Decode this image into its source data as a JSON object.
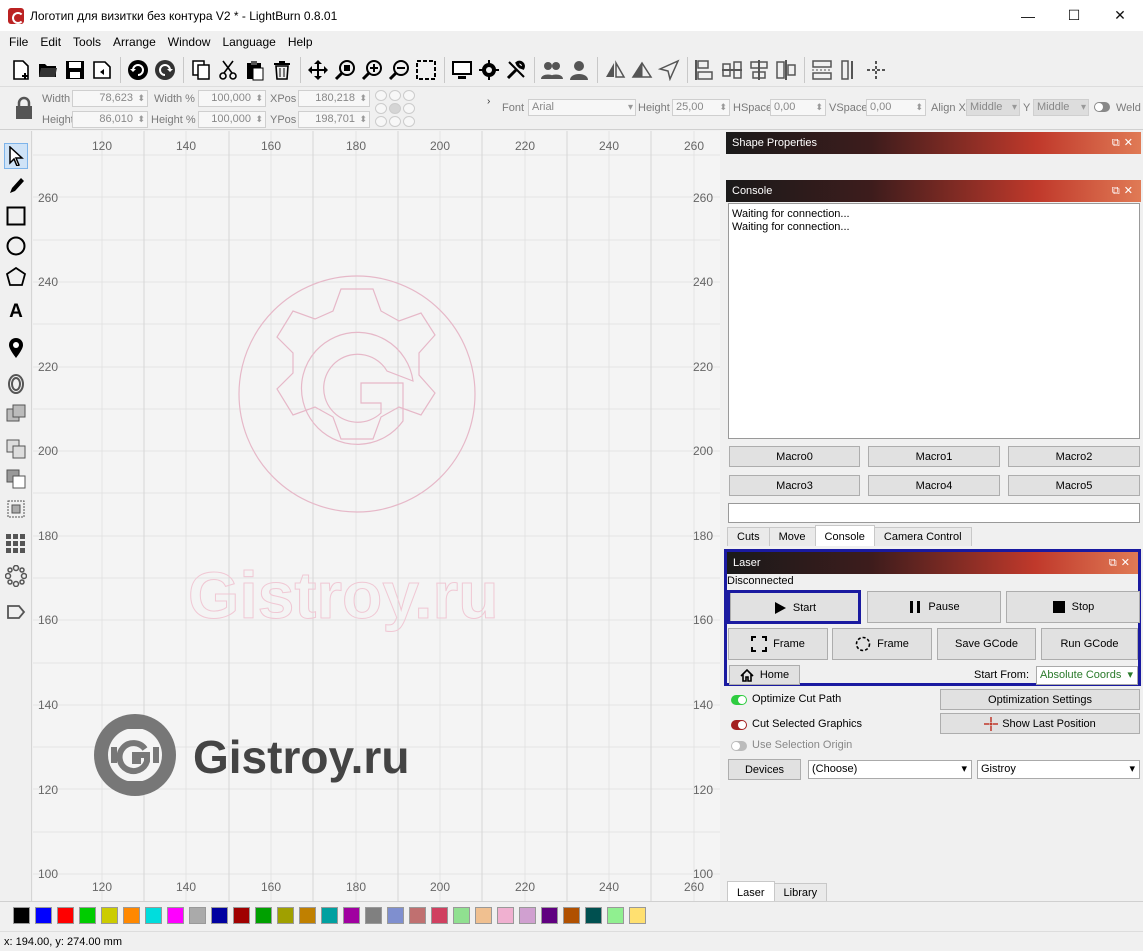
{
  "window": {
    "title": "Логотип для визитки без контура V2 * - LightBurn 0.8.01",
    "minimize": "—",
    "maximize": "☐",
    "close": "✕"
  },
  "menu": [
    "File",
    "Edit",
    "Tools",
    "Arrange",
    "Window",
    "Language",
    "Help"
  ],
  "toolbar1_icons": [
    "new-file-icon",
    "open-folder-icon",
    "save-icon",
    "save-as-icon",
    "undo-icon",
    "redo-icon",
    "copy-icon",
    "cut-icon",
    "paste-icon",
    "delete-icon",
    "move-icon",
    "zoom-selection-icon",
    "zoom-in-icon",
    "zoom-out-icon",
    "zoom-frame-icon",
    "monitor-icon",
    "settings-gear-icon",
    "tools-wrench-icon",
    "group-icon",
    "ungroup-icon",
    "flip-horizontal-icon",
    "flip-vertical-icon",
    "mirror-icon",
    "align-left-icon",
    "align-center-icon",
    "align-top-icon",
    "align-middle-icon",
    "distribute-h-icon",
    "distribute-v-icon",
    "center-icon"
  ],
  "toolbar2": {
    "width_label": "Width",
    "width_value": "78,623",
    "height_label": "Height",
    "height_value": "86,010",
    "width_pct_label": "Width %",
    "width_pct_value": "100,000",
    "height_pct_label": "Height %",
    "height_pct_value": "100,000",
    "xpos_label": "XPos",
    "xpos_value": "180,218",
    "ypos_label": "YPos",
    "ypos_value": "198,701",
    "font_label": "Font",
    "font_value": "Arial",
    "font_height_label": "Height",
    "font_height_value": "25,00",
    "hspace_label": "HSpace",
    "hspace_value": "0,00",
    "vspace_label": "VSpace",
    "vspace_value": "0,00",
    "alignx_label": "Align X",
    "alignx_value": "Middle",
    "aligny_label": "Y",
    "aligny_value": "Middle",
    "weld_label": "Weld"
  },
  "canvas": {
    "x_ticks": [
      "120",
      "140",
      "160",
      "180",
      "200",
      "220",
      "240",
      "260"
    ],
    "y_ticks": [
      "260",
      "240",
      "220",
      "200",
      "180",
      "160",
      "140",
      "120",
      "100"
    ],
    "watermark_text": "Gistroy.ru",
    "logo_text": "Gistroy.ru"
  },
  "shape_properties": {
    "title": "Shape Properties"
  },
  "console": {
    "title": "Console",
    "lines": [
      "Waiting for connection...",
      "Waiting for connection..."
    ],
    "macros": [
      "Macro0",
      "Macro1",
      "Macro2",
      "Macro3",
      "Macro4",
      "Macro5"
    ],
    "tabs": [
      "Cuts",
      "Move",
      "Console",
      "Camera Control"
    ]
  },
  "laser": {
    "title": "Laser",
    "status": "Disconnected",
    "start": "Start",
    "pause": "Pause",
    "stop": "Stop",
    "frame1": "Frame",
    "frame2": "Frame",
    "save_gcode": "Save GCode",
    "run_gcode": "Run GCode",
    "home": "Home",
    "start_from_label": "Start From:",
    "start_from_value": "Absolute Coords",
    "optimize_cut_path": "Optimize Cut Path",
    "optimization_settings": "Optimization Settings",
    "cut_selected_graphics": "Cut Selected Graphics",
    "show_last_position": "Show Last Position",
    "use_selection_origin": "Use Selection Origin",
    "devices": "Devices",
    "choose": "(Choose)",
    "device_name": "Gistroy"
  },
  "bottom_tabs": [
    "Laser",
    "Library"
  ],
  "palette_colors": [
    "#000000",
    "#0000ff",
    "#ff0000",
    "#00cc00",
    "#cccc00",
    "#ff8800",
    "#00dddd",
    "#ff00ff",
    "#aaaaaa",
    "#0000a0",
    "#a00000",
    "#00a000",
    "#a0a000",
    "#c08000",
    "#00a0a0",
    "#a000a0",
    "#808080",
    "#7f8fcf",
    "#c07070",
    "#d04060",
    "#90e090",
    "#f0c090",
    "#f0b0d0",
    "#d0a0d0",
    "#600080",
    "#b05000",
    "#005050",
    "#90f090",
    "#ffe070"
  ],
  "status_bar": "x: 194.00, y: 274.00 mm"
}
